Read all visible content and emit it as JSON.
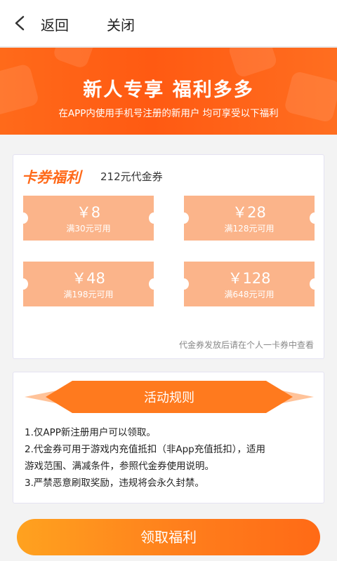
{
  "nav": {
    "back_label": "返回",
    "close_label": "关闭"
  },
  "banner": {
    "title": "新人专享  福利多多",
    "subtitle": "在APP内使用手机号注册的新用户 均可享受以下福利"
  },
  "coupons": {
    "title": "卡券福利",
    "total": "212元代金券",
    "items": [
      {
        "amount": "￥8",
        "condition": "满30元可用"
      },
      {
        "amount": "￥28",
        "condition": "满128元可用"
      },
      {
        "amount": "￥48",
        "condition": "满198元可用"
      },
      {
        "amount": "￥128",
        "condition": "满648元可用"
      }
    ],
    "note": "代金券发放后请在个人一卡券中查看"
  },
  "rules": {
    "title": "活动规则",
    "lines": [
      "1.仅APP新注册用户可以领取。",
      "2.代金券可用于游戏内充值抵扣（非App充值抵扣），适用",
      "游戏范围、满减条件，参照代金券使用说明。",
      "3.严禁恶意刷取奖励，违规将会永久封禁。"
    ]
  },
  "claim_button": {
    "label": "领取福利"
  },
  "colors": {
    "accent": "#ff6a1a",
    "coupon": "#fbb48a"
  },
  "icons": {
    "back": "chevron-left-icon"
  }
}
